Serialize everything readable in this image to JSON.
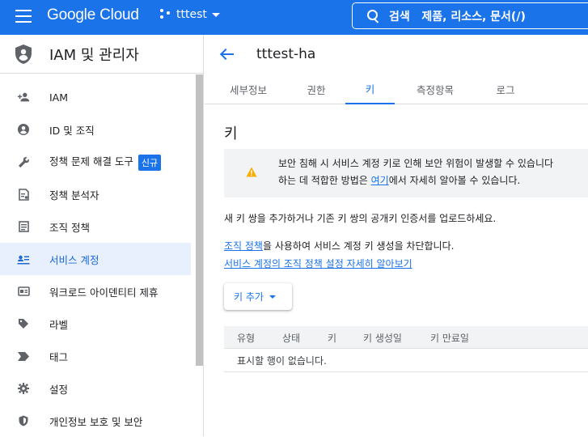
{
  "topbar": {
    "logo": "Google Cloud",
    "project": "tttest",
    "search_prefix": "검색",
    "search_hint": "제품, 리소스, 문서(/)"
  },
  "sidebar": {
    "title": "IAM 및 관리자",
    "items": [
      {
        "label": "IAM",
        "icon": "person-add-icon"
      },
      {
        "label": "ID 및 조직",
        "icon": "account-circle-icon"
      },
      {
        "label": "정책 문제 해결 도구",
        "icon": "wrench-icon",
        "badge": "신규"
      },
      {
        "label": "정책 분석자",
        "icon": "policy-analyzer-icon"
      },
      {
        "label": "조직 정책",
        "icon": "document-list-icon"
      },
      {
        "label": "서비스 계정",
        "icon": "service-account-icon",
        "active": true
      },
      {
        "label": "워크로드 아이덴티티 제휴",
        "icon": "id-card-icon"
      },
      {
        "label": "라벨",
        "icon": "label-icon"
      },
      {
        "label": "태그",
        "icon": "tag-icon"
      },
      {
        "label": "설정",
        "icon": "gear-icon"
      },
      {
        "label": "개인정보 보호 및 보안",
        "icon": "shield-icon"
      }
    ]
  },
  "main": {
    "title": "tttest-ha",
    "tabs": [
      "세부정보",
      "권한",
      "키",
      "측정항목",
      "로그"
    ],
    "active_tab": "키",
    "section_title": "키",
    "alert": {
      "line1": "보안 침해 시 서비스 계정 키로 인해 보안 위험이 발생할 수 있습니다",
      "line2_before": "하는 데 적합한 방법은 ",
      "line2_link": "여기",
      "line2_after": "에서 자세히 알아볼 수 있습니다."
    },
    "paragraph1": "새 키 쌍을 추가하거나 기존 키 쌍의 공개키 인증서를 업로드하세요.",
    "paragraph2_link": "조직 정책",
    "paragraph2_rest": "을 사용하여 서비스 계정 키 생성을 차단합니다.",
    "learn_more_link": "서비스 계정의 조직 정책 설정 자세히 알아보기",
    "add_key_button": "키 추가",
    "table": {
      "columns": [
        "유형",
        "상태",
        "키",
        "키 생성일",
        "키 만료일"
      ],
      "empty_text": "표시할 행이 없습니다."
    }
  },
  "colors": {
    "primary": "#1a73e8",
    "active_bg": "#e8f0fe",
    "warning": "#f9ab00"
  }
}
